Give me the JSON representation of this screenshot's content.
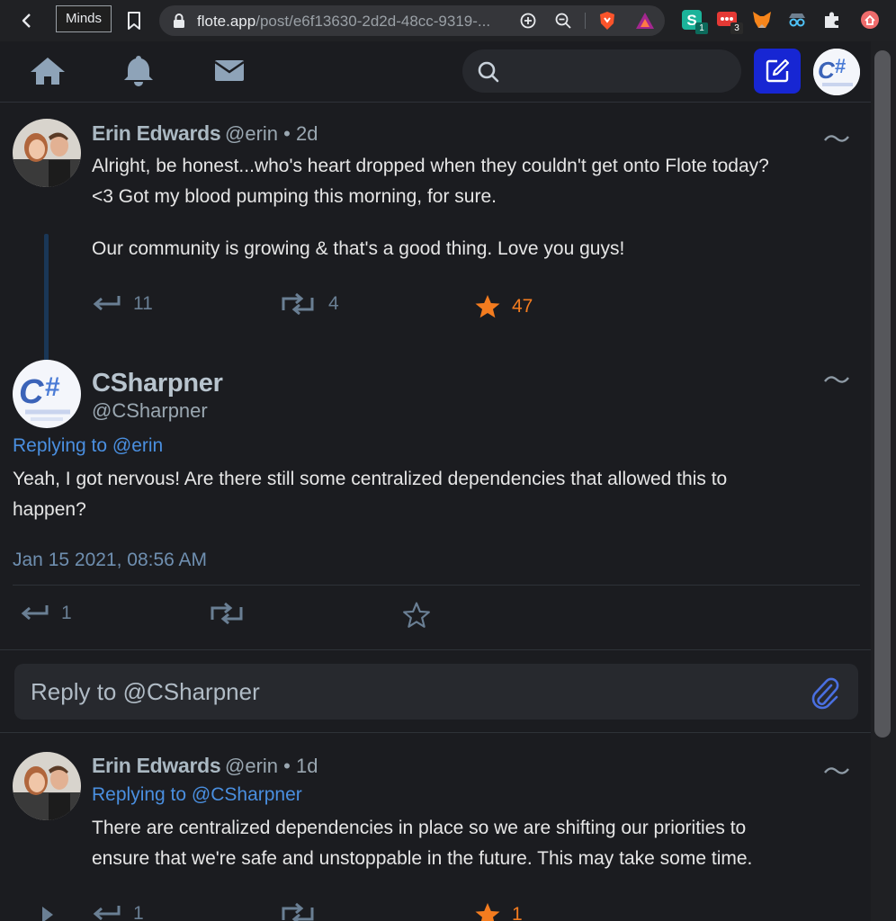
{
  "browser": {
    "tab_title": "Minds",
    "url_host": "flote.app",
    "url_path": "/post/e6f13630-2d2d-48cc-9319-...",
    "ext_badges": [
      "1",
      "3"
    ]
  },
  "nav": {
    "search_placeholder": ""
  },
  "thread": [
    {
      "name": "Erin Edwards",
      "handle": "@erin",
      "time": "• 2d",
      "text_lines": [
        "Alright, be honest...who's heart dropped when they couldn't get onto Flote today?",
        "<3 Got my blood pumping this morning, for sure."
      ],
      "text_para2": "Our community is growing & that's a good thing. Love you guys!",
      "replies": "11",
      "reposts": "4",
      "stars": "47"
    }
  ],
  "focus_post": {
    "name": "CSharpner",
    "handle": "@CSharpner",
    "replying_label": "Replying to",
    "replying_to": "@erin",
    "text_line1": "Yeah, I got nervous! Are there still some centralized dependencies that allowed this to",
    "text_line2": "happen?",
    "date": "Jan 15 2021, 08:56 AM",
    "replies": "1"
  },
  "reply_box": {
    "placeholder": "Reply to @CSharpner"
  },
  "reply_post": {
    "name": "Erin Edwards",
    "handle": "@erin",
    "time": "• 1d",
    "replying_label": "Replying to",
    "replying_to": "@CSharpner",
    "text_line1": "There are centralized dependencies in place so we are shifting our priorities to",
    "text_line2": "ensure that we're safe and unstoppable in the future. This may take some time.",
    "replies": "1",
    "stars": "1"
  },
  "colors": {
    "accent_blue": "#4a8fe0",
    "star_orange": "#f47c1f",
    "compose_bg": "#1726d3"
  }
}
